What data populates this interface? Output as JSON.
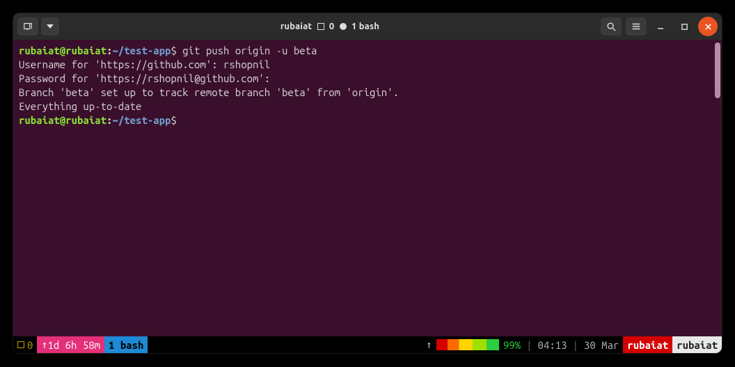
{
  "titlebar": {
    "title_left": "rubaiat",
    "title_count_a": "0",
    "title_count_b": "1",
    "title_right": "bash"
  },
  "terminal": {
    "prompt": {
      "user": "rubaiat",
      "at": "@",
      "host": "rubaiat",
      "colon": ":",
      "path": "~/test-app",
      "dollar": "$"
    },
    "lines": [
      {
        "type": "prompt",
        "cmd": "git push origin -u beta"
      },
      {
        "type": "out",
        "text": "Username for 'https://github.com': rshopnil"
      },
      {
        "type": "out",
        "text": "Password for 'https://rshopnil@github.com': "
      },
      {
        "type": "out",
        "text": "Branch 'beta' set up to track remote branch 'beta' from 'origin'."
      },
      {
        "type": "out",
        "text": "Everything up-to-date"
      },
      {
        "type": "prompt",
        "cmd": ""
      }
    ]
  },
  "status": {
    "session": "0",
    "uptime_arrow": "↑",
    "uptime": "1d 6h 58m",
    "window": "1 bash",
    "net_arrow": "↑",
    "battery_pct": "99%",
    "time": "04:13",
    "date": "30 Mar",
    "host": "rubaiat",
    "user": "rubaiat",
    "sep": "|"
  }
}
